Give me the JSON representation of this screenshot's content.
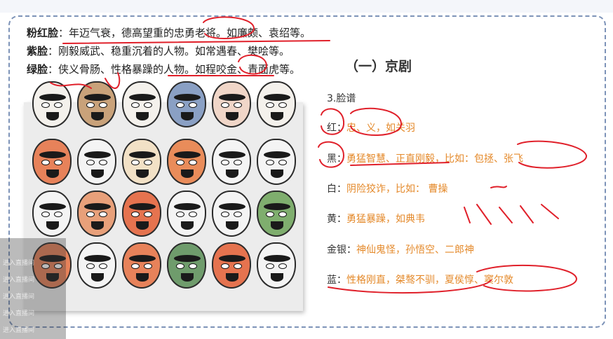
{
  "topbar": {
    "watermark": ""
  },
  "intro_lines": [
    {
      "key": "粉红脸",
      "text": "：年迈气衰，德高望重的忠勇老将。如廉颇、袁绍等。"
    },
    {
      "key": "紫脸",
      "text": "：刚毅威武、稳重沉着的人物。如常遇春、樊哙等。"
    },
    {
      "key": "绿脸",
      "text": "：侠义骨肠、性格暴躁的人物。如程咬金、青面虎等。"
    }
  ],
  "section_title": "（一）京剧",
  "sub_title": "3.脸谱",
  "colors_list": [
    {
      "key": "红",
      "sep": "：",
      "value": "忠、义，",
      "extra": "如关羽"
    },
    {
      "key": "黑",
      "sep": "：",
      "value": "勇猛智慧、正直刚毅，比如：包拯、张飞",
      "extra": ""
    },
    {
      "key": "白",
      "sep": "：",
      "value": "阴险狡诈，比如： 曹操",
      "extra": ""
    },
    {
      "key": "黄",
      "sep": "：",
      "value": "勇猛暴躁，如典韦",
      "extra": ""
    },
    {
      "key": "金银",
      "sep": "：",
      "value": "神仙鬼怪，孙悟空、二郎神",
      "extra": ""
    },
    {
      "key": "蓝",
      "sep": "：",
      "value": "性格刚直，桀骜不驯，夏侯惇、窦尔敦",
      "extra": ""
    }
  ],
  "sidebar_ghost": [
    "进入直播间",
    "进入直播间",
    "进入直播间",
    "进入直播间",
    "进入直播间"
  ],
  "mask_colors": [
    [
      "#f4f1ec",
      "#c9a27a",
      "#f4f1ec",
      "#8aa0c4",
      "#f0d6c8",
      "#f4f1ec"
    ],
    [
      "#e7825a",
      "#f4f4f4",
      "#f2e1c6",
      "#e98c5a",
      "#f4f4f4",
      "#f4f4f4"
    ],
    [
      "#f4f4f4",
      "#e8a07a",
      "#e5734f",
      "#f4f4f4",
      "#f4f4f4",
      "#7fae6e"
    ],
    [
      "#e7825a",
      "#f4f4f4",
      "#e7825a",
      "#6f9c6c",
      "#e5734f",
      "#f4f4f4"
    ]
  ],
  "accent_colors": {
    "orange": "#e4892a",
    "ink_red": "#e0202a",
    "frame_blue": "#7d93b8"
  }
}
